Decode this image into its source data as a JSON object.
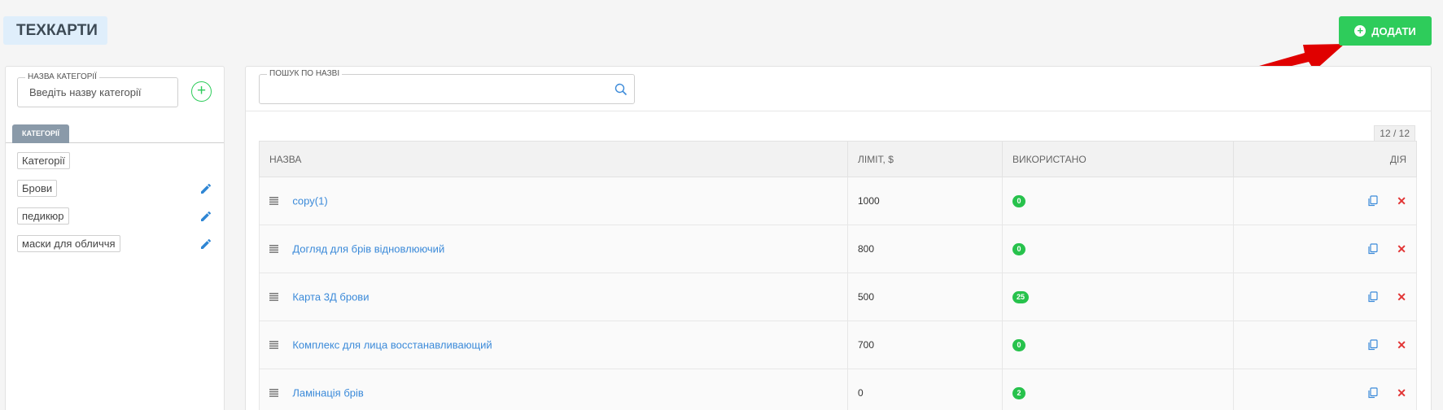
{
  "header": {
    "title": "ТЕХКАРТИ",
    "add_button_label": "ДОДАТИ"
  },
  "sidebar": {
    "category_field_label": "НАЗВА КАТЕГОРІЇ",
    "category_field_placeholder": "Введіть назву категорії",
    "tab_label": "КАТЕГОРІЇ",
    "items": [
      {
        "label": "Категорії",
        "editable": false
      },
      {
        "label": "Брови",
        "editable": true
      },
      {
        "label": "педикюр",
        "editable": true
      },
      {
        "label": "маски для обличчя",
        "editable": true
      }
    ]
  },
  "main": {
    "search_label": "ПОШУК ПО НАЗВІ",
    "search_value": "",
    "count": "12 / 12",
    "columns": {
      "name": "НАЗВА",
      "limit": "ЛІМІТ, $",
      "used": "ВИКОРИСТАНО",
      "actions": "ДІЯ"
    },
    "rows": [
      {
        "name": "copy(1)",
        "limit": "1000",
        "used": "0"
      },
      {
        "name": "Догляд для брів відновлюючий",
        "limit": "800",
        "used": "0"
      },
      {
        "name": "Карта 3Д брови",
        "limit": "500",
        "used": "25"
      },
      {
        "name": "Комплекс для лица восстанавливающий",
        "limit": "700",
        "used": "0"
      },
      {
        "name": "Ламінація брів",
        "limit": "0",
        "used": "2"
      }
    ]
  },
  "colors": {
    "accent_green": "#2ecc5b",
    "link_blue": "#3b8ad9",
    "delete_red": "#e23434",
    "annotation_arrow": "#e00000"
  },
  "icons": {
    "add": "plus-circle-icon",
    "edit": "pencil-icon",
    "search": "search-icon",
    "copy": "copy-icon",
    "delete": "close-icon",
    "drag": "drag-handle-icon"
  }
}
